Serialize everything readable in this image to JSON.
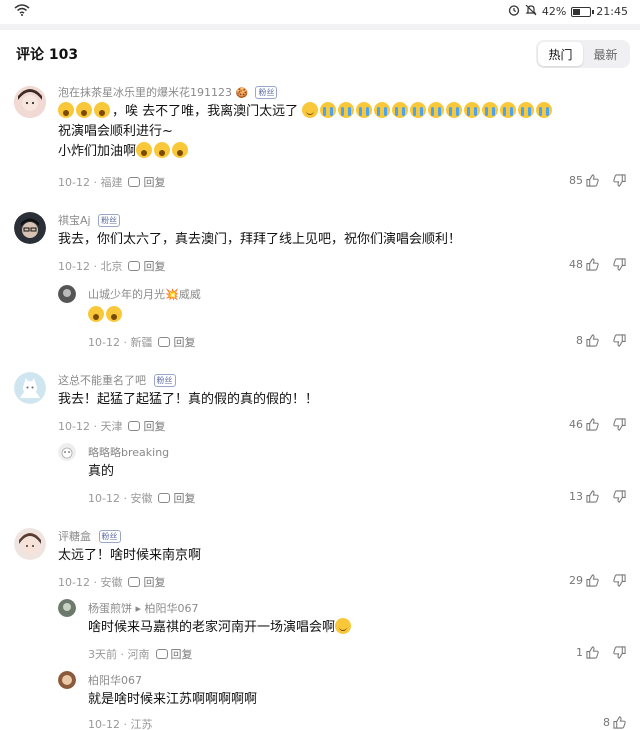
{
  "status": {
    "battery": "42%",
    "time": "21:45",
    "battery_level": 0.42
  },
  "header": {
    "title": "评论 103",
    "tab_hot": "热门",
    "tab_new": "最新"
  },
  "comments": [
    {
      "name": "泡在抹茶星冰乐里的爆米花191123",
      "badge": "粉丝",
      "text1": "，唉 去不了唯，我离澳门太远了",
      "text2": "祝演唱会顺利进行~",
      "text3": "小炸们加油啊",
      "date": "10-12 · 福建",
      "reply": "回复",
      "likes": "85"
    },
    {
      "name": "祺宝Aj",
      "badge": "粉丝",
      "text1": "我去，你们太六了，真去澳门，拜拜了线上见吧，祝你们演唱会顺利！",
      "date": "10-12 · 北京",
      "reply": "回复",
      "likes": "48",
      "sub": {
        "name": "山城少年的月光💥威威",
        "date": "10-12 · 新疆",
        "reply": "回复",
        "likes": "8"
      }
    },
    {
      "name": "这总不能重名了吧",
      "badge": "粉丝",
      "text1": "我去！起猛了起猛了！真的假的真的假的！！",
      "date": "10-12 · 天津",
      "reply": "回复",
      "likes": "46",
      "sub": {
        "name": "略略略breaking",
        "text": "真的",
        "date": "10-12 · 安徽",
        "reply": "回复",
        "likes": "13"
      }
    },
    {
      "name": "评糖盒",
      "badge": "粉丝",
      "text1": "太远了！啥时候来南京啊",
      "date": "10-12 · 安徽",
      "reply": "回复",
      "likes": "29",
      "sub": {
        "name": "杨蛋煎饼 ▸ 柏阳华067",
        "text": "啥时候来马嘉祺的老家河南开一场演唱会啊",
        "date": "3天前 · 河南",
        "reply": "回复",
        "likes": "1"
      },
      "sub2": {
        "name": "柏阳华067",
        "text": "就是啥时候来江苏啊啊啊啊啊",
        "date": "10-12 · 江苏",
        "likes": "8"
      }
    }
  ]
}
